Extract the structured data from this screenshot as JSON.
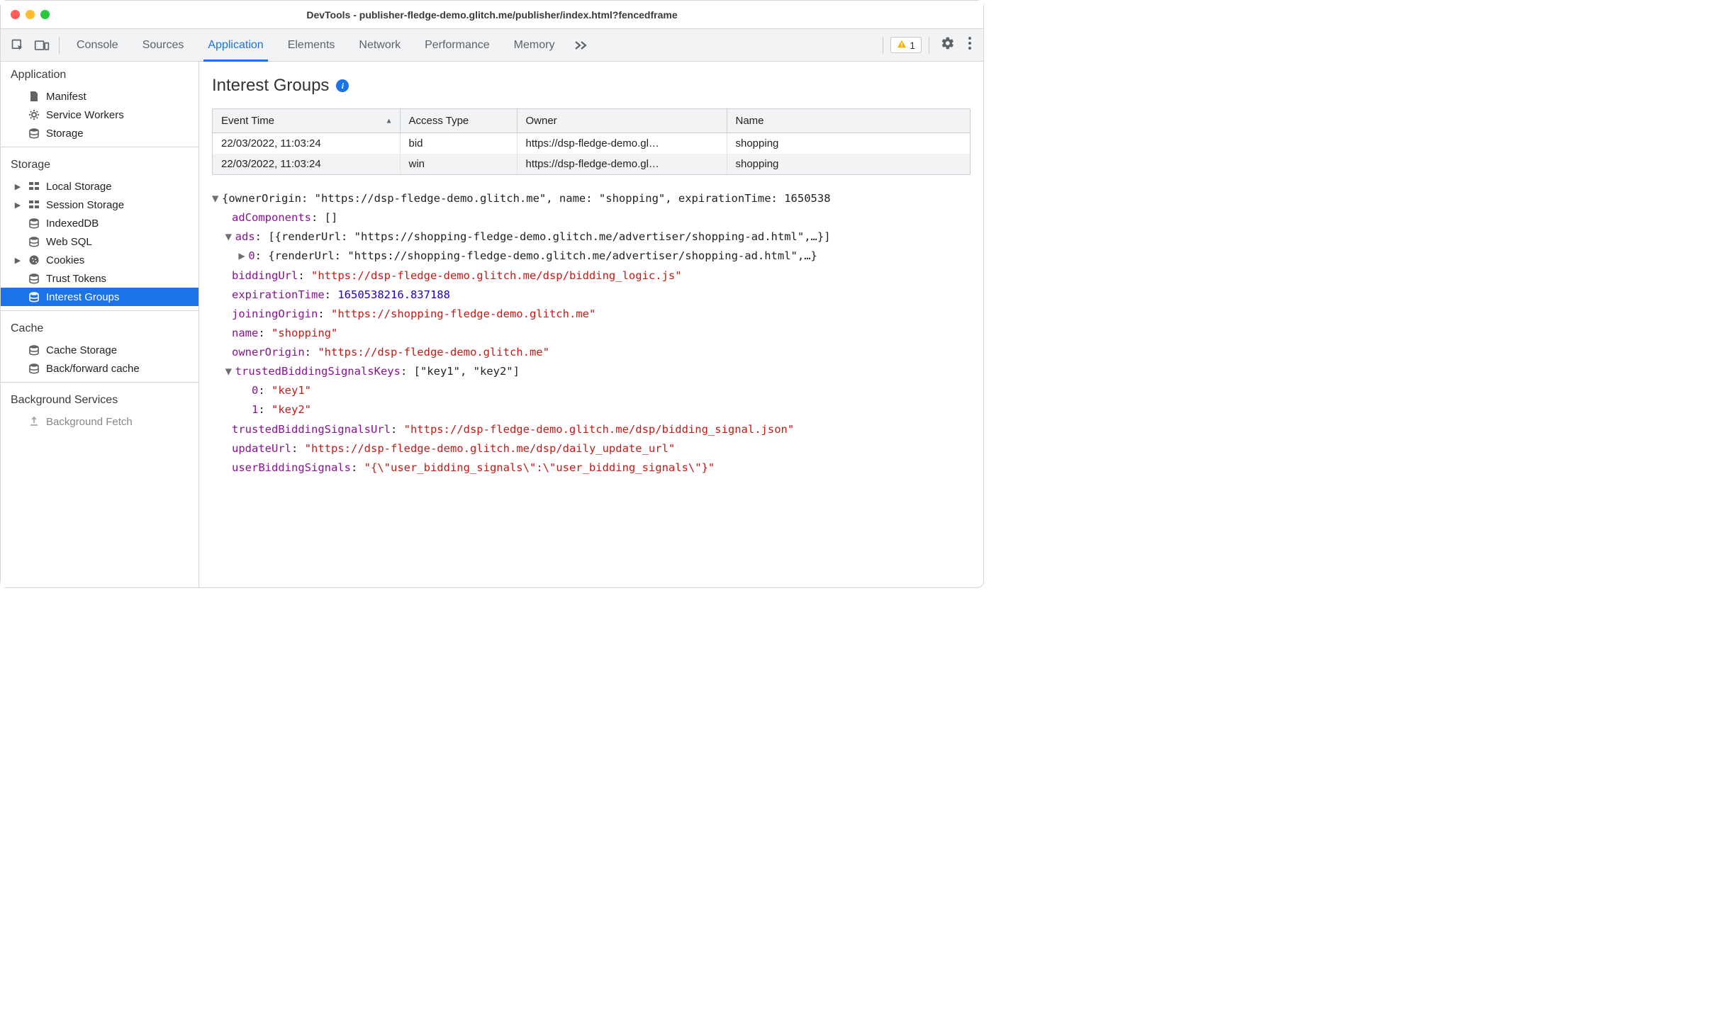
{
  "window": {
    "title": "DevTools - publisher-fledge-demo.glitch.me/publisher/index.html?fencedframe"
  },
  "toolbar": {
    "tabs": [
      "Console",
      "Sources",
      "Application",
      "Elements",
      "Network",
      "Performance",
      "Memory"
    ],
    "activeIndex": 2,
    "warningCount": "1"
  },
  "sidebar": {
    "sections": [
      {
        "title": "Application",
        "items": [
          {
            "label": "Manifest",
            "icon": "file"
          },
          {
            "label": "Service Workers",
            "icon": "gear"
          },
          {
            "label": "Storage",
            "icon": "db"
          }
        ]
      },
      {
        "title": "Storage",
        "items": [
          {
            "label": "Local Storage",
            "icon": "grid",
            "expandable": true
          },
          {
            "label": "Session Storage",
            "icon": "grid",
            "expandable": true
          },
          {
            "label": "IndexedDB",
            "icon": "db"
          },
          {
            "label": "Web SQL",
            "icon": "db"
          },
          {
            "label": "Cookies",
            "icon": "cookie",
            "expandable": true
          },
          {
            "label": "Trust Tokens",
            "icon": "db"
          },
          {
            "label": "Interest Groups",
            "icon": "db",
            "selected": true
          }
        ]
      },
      {
        "title": "Cache",
        "items": [
          {
            "label": "Cache Storage",
            "icon": "db"
          },
          {
            "label": "Back/forward cache",
            "icon": "db"
          }
        ]
      },
      {
        "title": "Background Services",
        "items": [
          {
            "label": "Background Fetch",
            "icon": "upload"
          }
        ]
      }
    ]
  },
  "panel": {
    "title": "Interest Groups",
    "table": {
      "headers": [
        "Event Time",
        "Access Type",
        "Owner",
        "Name"
      ],
      "rows": [
        {
          "time": "22/03/2022, 11:03:24",
          "access": "bid",
          "owner": "https://dsp-fledge-demo.gl…",
          "name": "shopping"
        },
        {
          "time": "22/03/2022, 11:03:24",
          "access": "win",
          "owner": "https://dsp-fledge-demo.gl…",
          "name": "shopping"
        }
      ]
    },
    "object": {
      "summary": "{ownerOrigin: \"https://dsp-fledge-demo.glitch.me\", name: \"shopping\", expirationTime: 1650538",
      "adComponents": "[]",
      "adsSummary": "[{renderUrl: \"https://shopping-fledge-demo.glitch.me/advertiser/shopping-ad.html\",…}]",
      "ads0": "{renderUrl: \"https://shopping-fledge-demo.glitch.me/advertiser/shopping-ad.html\",…}",
      "biddingUrl": "\"https://dsp-fledge-demo.glitch.me/dsp/bidding_logic.js\"",
      "expirationTime": "1650538216.837188",
      "joiningOrigin": "\"https://shopping-fledge-demo.glitch.me\"",
      "name_": "\"shopping\"",
      "ownerOrigin": "\"https://dsp-fledge-demo.glitch.me\"",
      "tbsKeys": "[\"key1\", \"key2\"]",
      "tbsKey0": "\"key1\"",
      "tbsKey1": "\"key2\"",
      "trustedBiddingSignalsUrl": "\"https://dsp-fledge-demo.glitch.me/dsp/bidding_signal.json\"",
      "updateUrl": "\"https://dsp-fledge-demo.glitch.me/dsp/daily_update_url\"",
      "userBiddingSignals": "\"{\\\"user_bidding_signals\\\":\\\"user_bidding_signals\\\"}\""
    }
  }
}
